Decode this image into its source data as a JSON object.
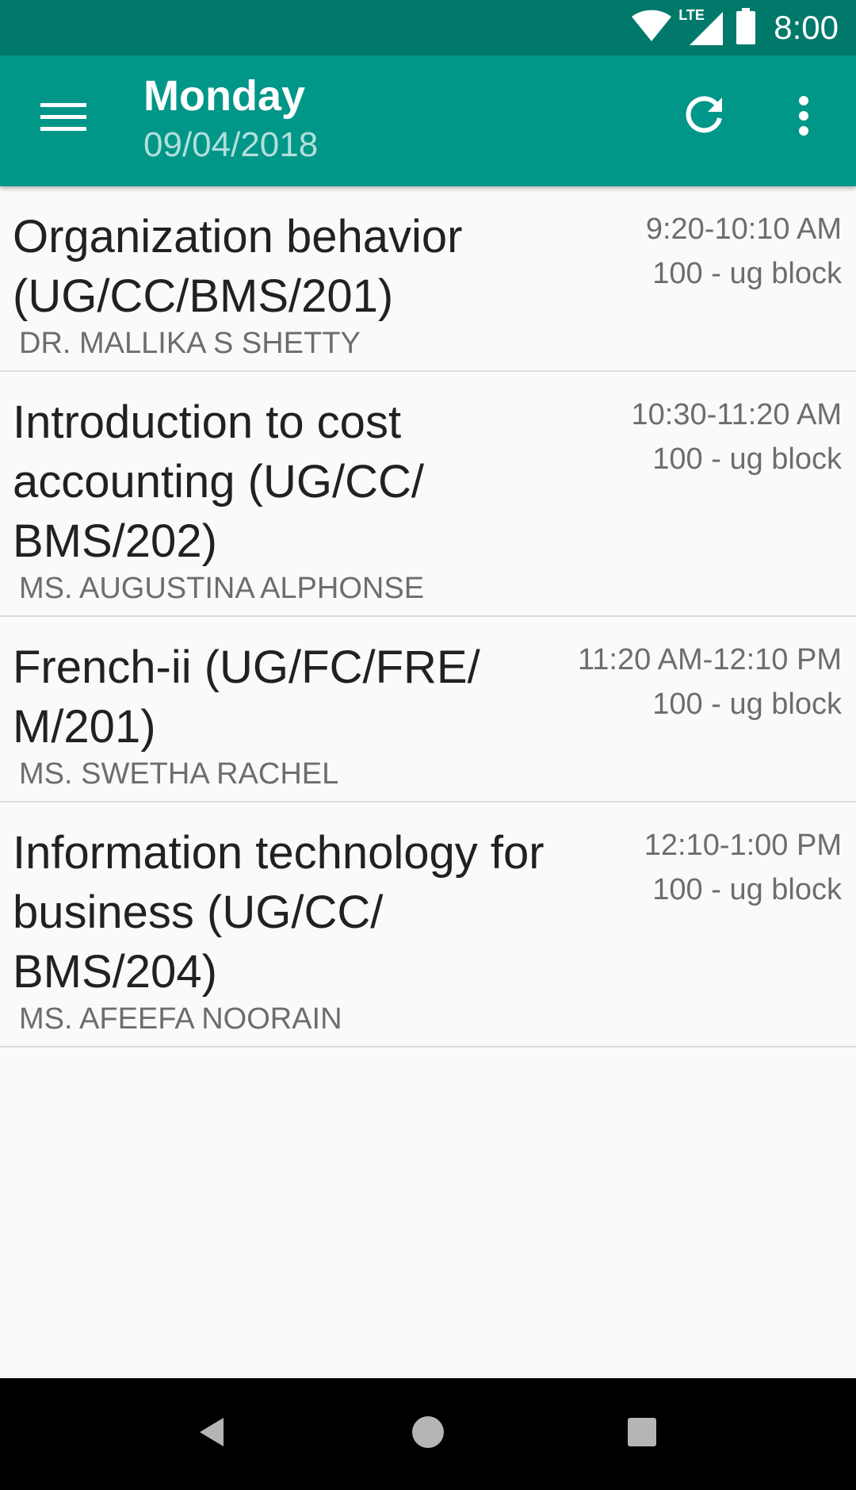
{
  "status_bar": {
    "time": "8:00",
    "network_label": "LTE",
    "icons": [
      "wifi-icon",
      "lte-signal-icon",
      "battery-icon"
    ]
  },
  "app_bar": {
    "title": "Monday",
    "subtitle": "09/04/2018",
    "color": "#009688",
    "status_color": "#00796b",
    "icons": [
      "menu-icon",
      "refresh-icon",
      "more-vert-icon"
    ]
  },
  "classes": [
    {
      "title": "Organization behavior (UG/CC/BMS/201)",
      "time": "9:20-10:10 AM",
      "room": "100 - ug block",
      "instructor": "DR. MALLIKA S SHETTY"
    },
    {
      "title": "Introduction to cost accounting (UG/CC/ BMS/202)",
      "time": "10:30-11:20 AM",
      "room": "100 - ug block",
      "instructor": "MS. AUGUSTINA ALPHONSE"
    },
    {
      "title": "French-ii (UG/FC/FRE/ M/201)",
      "time": "11:20 AM-12:10 PM",
      "room": "100 - ug block",
      "instructor": "MS. SWETHA RACHEL"
    },
    {
      "title": "Information technology for business (UG/CC/ BMS/204)",
      "time": "12:10-1:00 PM",
      "room": "100 - ug block",
      "instructor": "MS. AFEEFA NOORAIN"
    }
  ],
  "nav_bar": {
    "icons": [
      "back-icon",
      "home-icon",
      "recents-icon"
    ]
  }
}
